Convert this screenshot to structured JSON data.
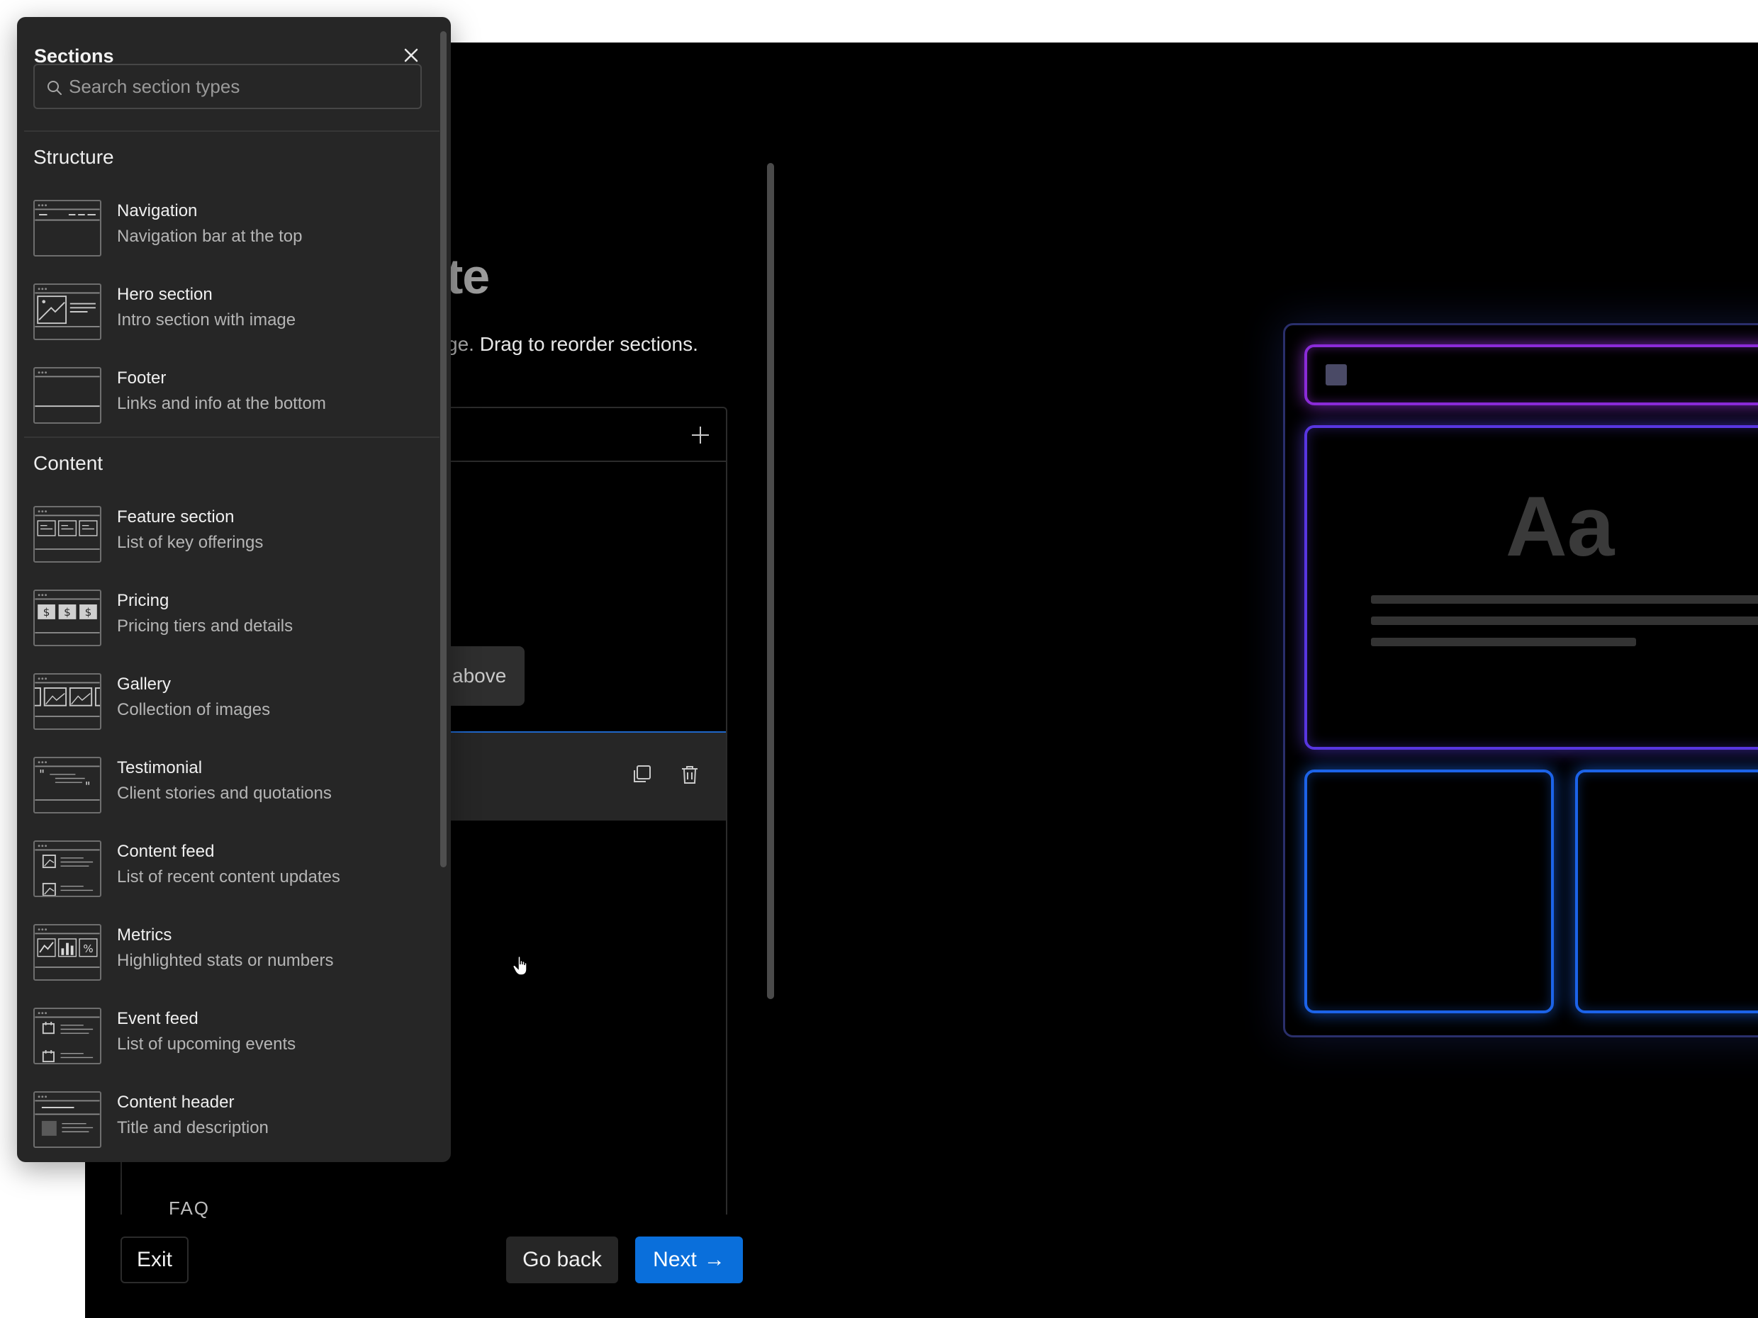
{
  "main": {
    "heading_fragment": "te",
    "description_dim": "ge.",
    "description_main": " Drag to reorder sections.",
    "tooltip_fragment": "above",
    "faq_fragment": "FAQ"
  },
  "buttons": {
    "exit": "Exit",
    "go_back": "Go back",
    "next": "Next"
  },
  "preview": {
    "aa": "Aa"
  },
  "sidebar": {
    "title": "Sections",
    "search_placeholder": "Search section types",
    "groups": [
      {
        "title": "Structure",
        "items": [
          {
            "name": "Navigation",
            "desc": "Navigation bar at the top",
            "icon": "navigation-thumb-icon"
          },
          {
            "name": "Hero section",
            "desc": "Intro section with image",
            "icon": "hero-thumb-icon"
          },
          {
            "name": "Footer",
            "desc": "Links and info at the bottom",
            "icon": "footer-thumb-icon"
          }
        ]
      },
      {
        "title": "Content",
        "items": [
          {
            "name": "Feature section",
            "desc": "List of key offerings",
            "icon": "feature-thumb-icon"
          },
          {
            "name": "Pricing",
            "desc": "Pricing tiers and details",
            "icon": "pricing-thumb-icon"
          },
          {
            "name": "Gallery",
            "desc": "Collection of images",
            "icon": "gallery-thumb-icon"
          },
          {
            "name": "Testimonial",
            "desc": "Client stories and quotations",
            "icon": "testimonial-thumb-icon"
          },
          {
            "name": "Content feed",
            "desc": "List of recent content updates",
            "icon": "content-feed-thumb-icon"
          },
          {
            "name": "Metrics",
            "desc": "Highlighted stats or numbers",
            "icon": "metrics-thumb-icon"
          },
          {
            "name": "Event feed",
            "desc": "List of upcoming events",
            "icon": "event-feed-thumb-icon"
          },
          {
            "name": "Content header",
            "desc": "Title and description",
            "icon": "content-header-thumb-icon"
          }
        ]
      }
    ]
  },
  "colors": {
    "accent": "#0a6fdb",
    "sidebar_bg": "#262626",
    "main_bg": "#000000",
    "neon_purple": "#8a2bd8",
    "neon_blue": "#1c63e8"
  }
}
